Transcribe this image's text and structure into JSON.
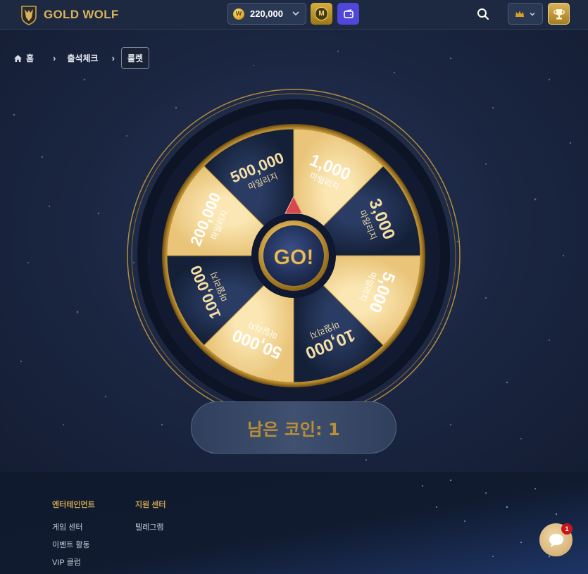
{
  "header": {
    "brand": "GOLD WOLF",
    "balance": "220,000",
    "coin_symbol": "W",
    "mileage_symbol": "M",
    "icons": [
      "wolf-logo-icon",
      "coin-icon",
      "chevron-down-icon",
      "mileage-icon",
      "wallet-icon",
      "search-icon",
      "crown-icon",
      "trophy-icon"
    ]
  },
  "breadcrumb": {
    "home": "홈",
    "attendance": "출석체크",
    "current": "룰렛"
  },
  "roulette": {
    "go_label": "GO!",
    "segments": [
      {
        "amount": "1,000",
        "unit": "마일리지",
        "color": "light"
      },
      {
        "amount": "3,000",
        "unit": "마일리지",
        "color": "dark"
      },
      {
        "amount": "5,000",
        "unit": "마일리지",
        "color": "light"
      },
      {
        "amount": "10,000",
        "unit": "마일리지",
        "color": "dark"
      },
      {
        "amount": "50,000",
        "unit": "마일리지",
        "color": "light"
      },
      {
        "amount": "100,000",
        "unit": "마일리지",
        "color": "dark"
      },
      {
        "amount": "200,000",
        "unit": "마일리지",
        "color": "light"
      },
      {
        "amount": "500,000",
        "unit": "마일리지",
        "color": "dark"
      }
    ],
    "remaining_coins": "남은 코인: 1"
  },
  "footer": {
    "columns": [
      {
        "title": "엔터테인먼트",
        "items": [
          "게임 센터",
          "이벤트 활동",
          "VIP 클럽"
        ]
      },
      {
        "title": "지원 센터",
        "items": [
          "텔레그램"
        ]
      }
    ]
  },
  "chat": {
    "badge": "1"
  },
  "colors": {
    "gold": "#d9b25b",
    "segment_light": "#f3d79a",
    "segment_dark": "#1c2a4a",
    "background": "#18233a"
  }
}
